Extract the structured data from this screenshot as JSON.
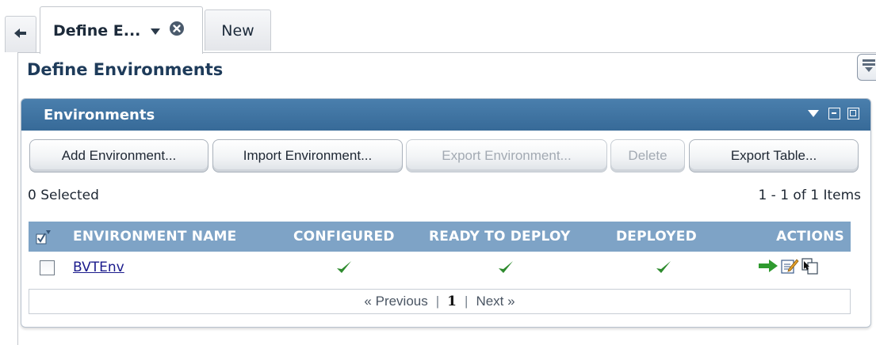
{
  "tabs": {
    "back_icon": "left-arrow-icon",
    "active_label": "Define E...",
    "active_dropdown_icon": "chevron-down-icon",
    "active_close_icon": "close-icon",
    "new_label": "New"
  },
  "page": {
    "title": "Define Environments",
    "collapse_icon": "panel-collapse-icon"
  },
  "panel": {
    "title": "Environments",
    "controls": [
      "menu-triangle-icon",
      "minimize-icon",
      "maximize-icon"
    ]
  },
  "toolbar": {
    "add_label": "Add Environment...",
    "import_label": "Import Environment...",
    "export_label": "Export Environment...",
    "delete_label": "Delete",
    "export_table_label": "Export Table..."
  },
  "status": {
    "selected": "0 Selected",
    "range": "1 - 1 of 1 Items"
  },
  "table": {
    "columns": [
      "ENVIRONMENT NAME",
      "CONFIGURED",
      "READY TO DEPLOY",
      "DEPLOYED",
      "ACTIONS"
    ],
    "rows": [
      {
        "name": "BVTEnv",
        "configured": true,
        "ready_to_deploy": true,
        "deployed": true,
        "actions": [
          "deploy-arrow-icon",
          "edit-icon",
          "copy-icon"
        ]
      }
    ]
  },
  "pager": {
    "previous": "« Previous",
    "separator": "|",
    "current": "1",
    "next": "Next »"
  },
  "colors": {
    "panel_header": "#3f74a3",
    "table_header": "#7ea3c6",
    "check_green": "#2e8b2e",
    "title_blue": "#1e3b5a"
  }
}
